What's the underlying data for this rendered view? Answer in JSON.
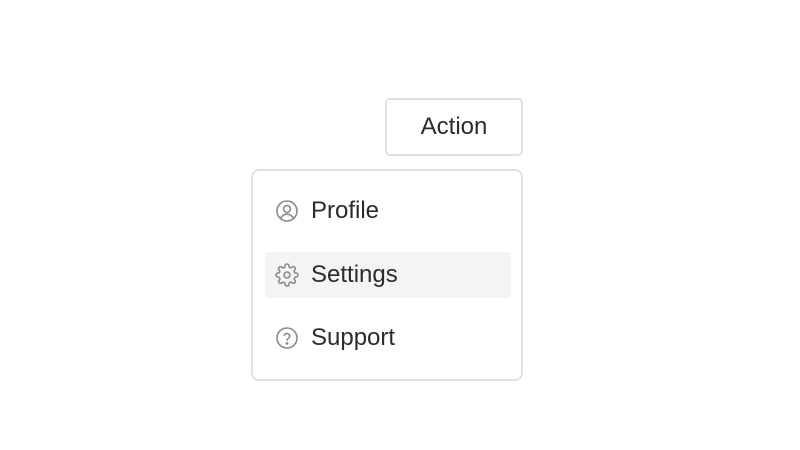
{
  "action_button": {
    "label": "Action"
  },
  "menu": {
    "items": [
      {
        "label": "Profile",
        "icon": "user-circle-icon",
        "highlighted": false
      },
      {
        "label": "Settings",
        "icon": "gear-icon",
        "highlighted": true
      },
      {
        "label": "Support",
        "icon": "help-circle-icon",
        "highlighted": false
      }
    ]
  },
  "colors": {
    "border": "#e0e0e0",
    "text": "#2b2b2b",
    "icon": "#8a8a8a",
    "highlight_bg": "#f4f4f4"
  }
}
